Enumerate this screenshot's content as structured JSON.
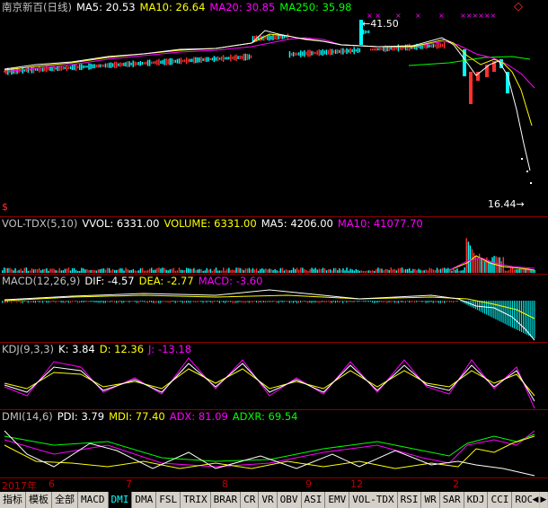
{
  "main": {
    "title": "南京新百(日线)",
    "ma5": "MA5: 20.53",
    "ma10": "MA10: 26.64",
    "ma20": "MA20: 30.85",
    "ma250": "MA250: 35.98",
    "high_label": "41.50",
    "low_label": "16.44",
    "corner_icon": "diamond-icon",
    "s_marker": "$"
  },
  "volume": {
    "title": "VOL-TDX(5,10)",
    "vvol": "VVOL: 6331.00",
    "volume": "VOLUME: 6331.00",
    "ma5": "MA5: 4206.00",
    "ma10": "MA10: 41077.70"
  },
  "macd": {
    "title": "MACD(12,26,9)",
    "dif": "DIF: -4.57",
    "dea": "DEA: -2.77",
    "macd": "MACD: -3.60"
  },
  "kdj": {
    "title": "KDJ(9,3,3)",
    "k": "K: 3.84",
    "d": "D: 12.36",
    "j": "J: -13.18"
  },
  "dmi": {
    "title": "DMI(14,6)",
    "pdi": "PDI: 3.79",
    "mdi": "MDI: 77.40",
    "adx": "ADX: 81.09",
    "adxr": "ADXR: 69.54"
  },
  "dates": [
    "2017年",
    "6",
    "7",
    "8",
    "9",
    "12",
    "2"
  ],
  "tabs": [
    "指标",
    "模板",
    "全部",
    "MACD",
    "DMI",
    "DMA",
    "FSL",
    "TRIX",
    "BRAR",
    "CR",
    "VR",
    "OBV",
    "ASI",
    "EMV",
    "VOL-TDX",
    "RSI",
    "WR",
    "SAR",
    "KDJ",
    "CCI",
    "ROC"
  ],
  "active_tab": "DMI",
  "colors": {
    "ma5": "#ffffff",
    "ma10": "#ffff00",
    "ma20": "#ff00ff",
    "ma250": "#00ff00",
    "up": "#ff3030",
    "down": "#00ffff",
    "grid": "#8b0000",
    "date": "#c00000"
  }
}
